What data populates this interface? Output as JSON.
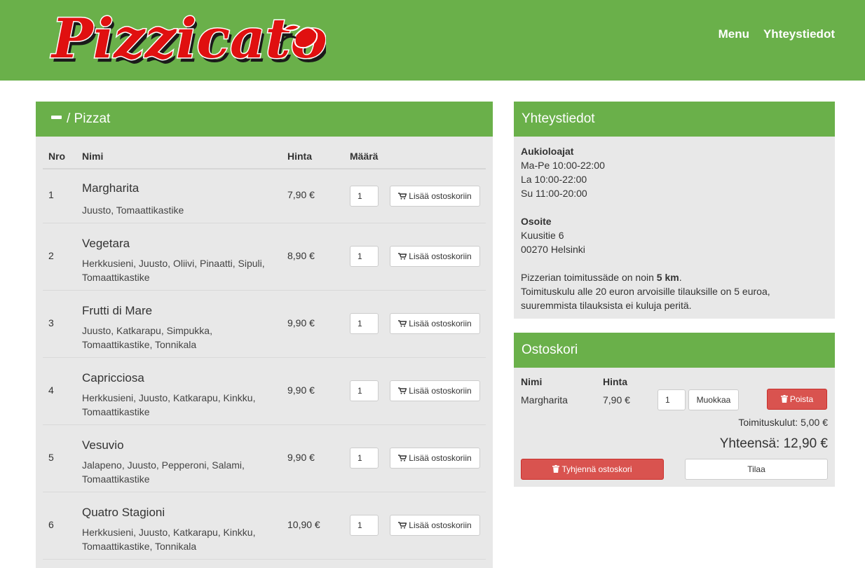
{
  "header": {
    "logo_text": "Pizzicato",
    "nav": [
      "Menu",
      "Yhteystiedot"
    ]
  },
  "menu": {
    "title": "/ Pizzat",
    "columns": [
      "Nro",
      "Nimi",
      "Hinta",
      "Määrä"
    ],
    "add_label": "Lisää ostoskoriin",
    "items": [
      {
        "nro": "1",
        "name": "Margharita",
        "ingredients": "Juusto, Tomaattikastike",
        "price": "7,90 €",
        "qty": "1"
      },
      {
        "nro": "2",
        "name": "Vegetara",
        "ingredients": "Herkkusieni, Juusto, Oliivi, Pinaatti, Sipuli, Tomaattikastike",
        "price": "8,90 €",
        "qty": "1"
      },
      {
        "nro": "3",
        "name": "Frutti di Mare",
        "ingredients": "Juusto, Katkarapu, Simpukka, Tomaattikastike, Tonnikala",
        "price": "9,90 €",
        "qty": "1"
      },
      {
        "nro": "4",
        "name": "Capricciosa",
        "ingredients": "Herkkusieni, Juusto, Katkarapu, Kinkku, Tomaattikastike",
        "price": "9,90 €",
        "qty": "1"
      },
      {
        "nro": "5",
        "name": "Vesuvio",
        "ingredients": "Jalapeno, Juusto, Pepperoni, Salami, Tomaattikastike",
        "price": "9,90 €",
        "qty": "1"
      },
      {
        "nro": "6",
        "name": "Quatro Stagioni",
        "ingredients": "Herkkusieni, Juusto, Katkarapu, Kinkku, Tomaattikastike, Tonnikala",
        "price": "10,90 €",
        "qty": "1"
      }
    ]
  },
  "contact": {
    "title": "Yhteystiedot",
    "hours_label": "Aukioloajat",
    "hours": [
      "Ma-Pe 10:00-22:00",
      "La 10:00-22:00",
      "Su 11:00-20:00"
    ],
    "address_label": "Osoite",
    "address": [
      "Kuusitie 6",
      "00270 Helsinki"
    ],
    "delivery_prefix": "Pizzerian toimitussäde on noin ",
    "delivery_radius": "5 km",
    "delivery_suffix": ".",
    "fee_line1": "Toimituskulu alle 20 euron arvoisille tilauksille on 5 euroa,",
    "fee_line2": "suuremmista tilauksista ei kuluja peritä."
  },
  "cart": {
    "title": "Ostoskori",
    "col_name": "Nimi",
    "col_price": "Hinta",
    "item": {
      "name": "Margharita",
      "price": "7,90 €",
      "qty": "1"
    },
    "edit_label": "Muokkaa",
    "remove_label": "Poista",
    "delivery_fee": "Toimituskulut: 5,00 €",
    "total": "Yhteensä: 12,90 €",
    "clear_label": "Tyhjennä ostoskori",
    "order_label": "Tilaa"
  },
  "colors": {
    "brand_green": "#6ab04a",
    "danger_red": "#d9534f",
    "panel_grey": "#e8e8e8"
  }
}
